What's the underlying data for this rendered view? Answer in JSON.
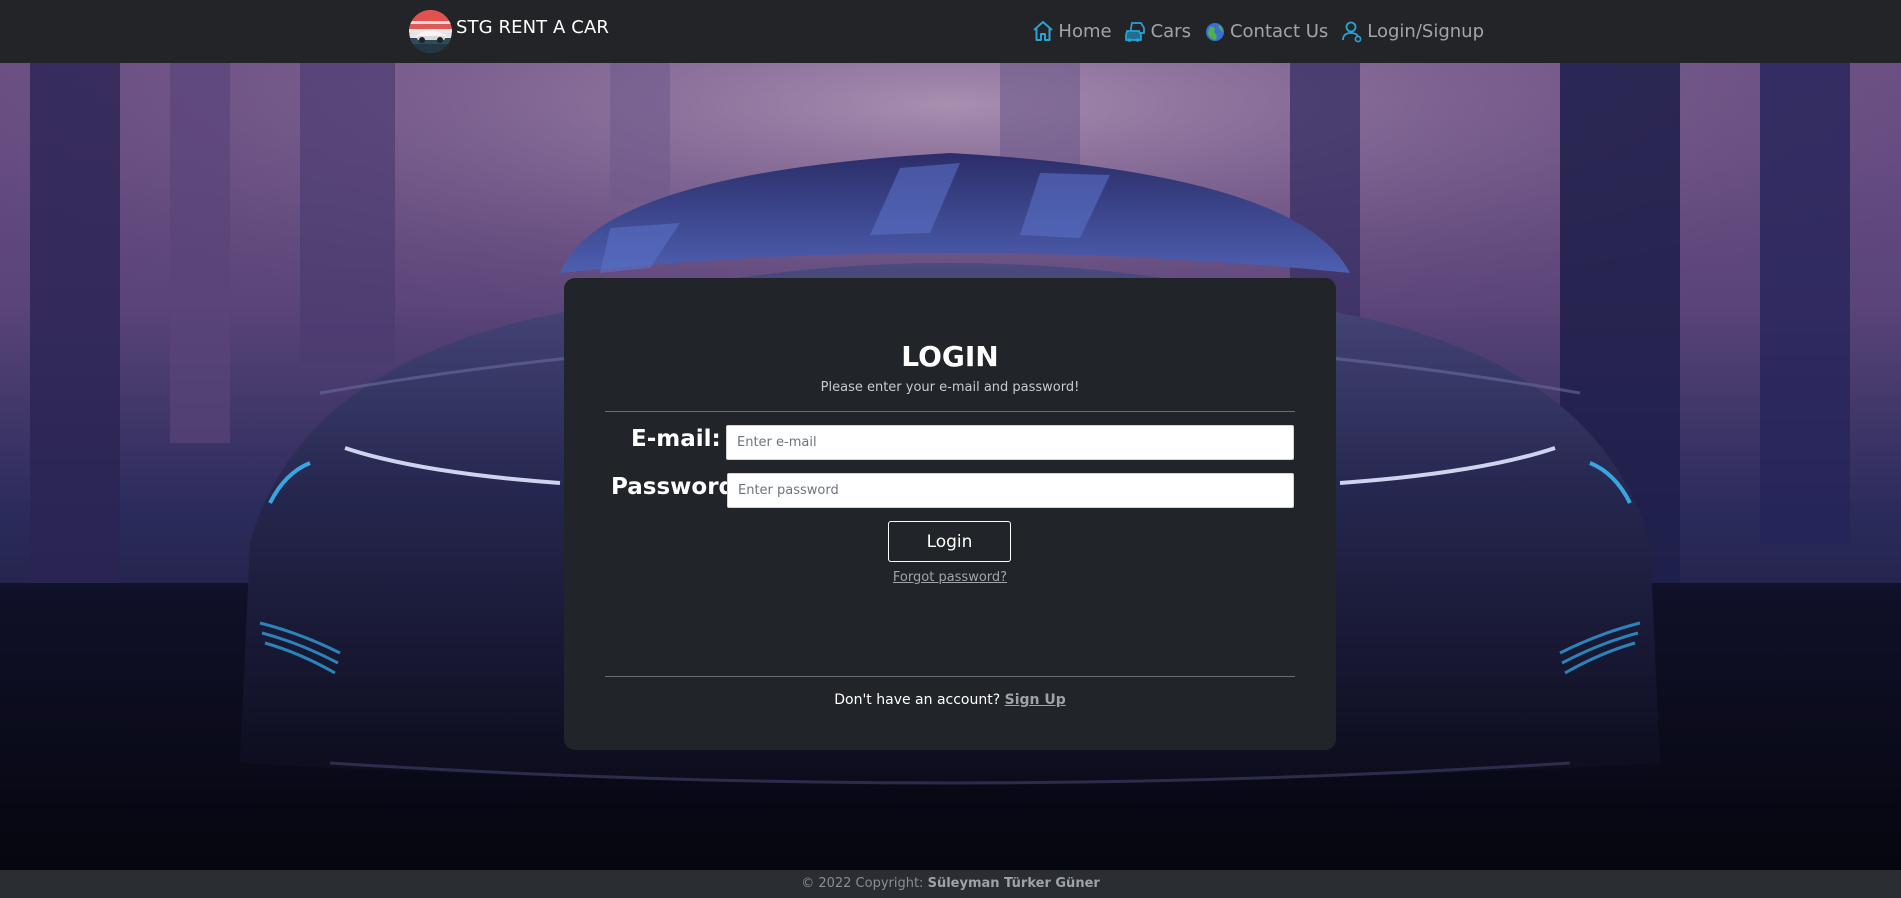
{
  "navbar": {
    "brand_name": "STG RENT A CAR",
    "brand_logo_icon": "car-badge-icon",
    "items": [
      {
        "label": "Home",
        "icon": "house-icon"
      },
      {
        "label": "Cars",
        "icon": "cars-icon"
      },
      {
        "label": "Contact Us",
        "icon": "globe-icon"
      },
      {
        "label": "Login/Signup",
        "icon": "user-icon"
      }
    ]
  },
  "login": {
    "title": "LOGIN",
    "subtitle": "Please enter your e-mail and password!",
    "email_label": "E-mail:",
    "email_placeholder": "Enter e-mail",
    "email_value": "",
    "password_label": "Password:",
    "password_placeholder": "Enter password",
    "password_value": "",
    "button_label": "Login",
    "forgot_label": "Forgot password?",
    "no_account_text": "Don't have an account?",
    "signup_label": "Sign Up"
  },
  "footer": {
    "copyright": "© 2022 Copyright:",
    "author": "Süleyman Türker Güner"
  },
  "colors": {
    "navbar_bg": "#222428",
    "card_bg": "#212529",
    "nav_text": "#a0a5ab",
    "nav_icon": "#29a3d6",
    "footer_bg": "#2a2d31"
  }
}
